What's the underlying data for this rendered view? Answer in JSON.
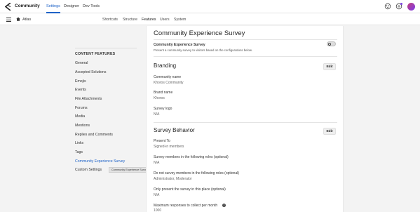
{
  "topnav": {
    "brand": "Community",
    "items": [
      "Settings",
      "Designer",
      "Dev Tools"
    ]
  },
  "subnav": {
    "home_label": "Atlas",
    "items": [
      "Shortcuts",
      "Structure",
      "Features",
      "Users",
      "System"
    ]
  },
  "sidebar": {
    "title": "CONTENT FEATURES",
    "items": [
      "General",
      "Accepted Solutions",
      "Emojis",
      "Events",
      "File Attachments",
      "Forums",
      "Media",
      "Mentions",
      "Replies and Comments",
      "Links",
      "Tags",
      "Community Experience Survey",
      "Custom Settings"
    ],
    "tooltip": "Community Experience Survey"
  },
  "main": {
    "title": "Community Experience Survey",
    "feature": {
      "title": "Community Experience Survey",
      "description": "Present a community survey to visitors based on the configurations below.",
      "enabled": false
    },
    "branding": {
      "heading": "Branding",
      "edit_label": "Edit",
      "fields": [
        {
          "label": "Community name",
          "value": "Khoros Community"
        },
        {
          "label": "Brand name",
          "value": "Khoros"
        },
        {
          "label": "Survey logo",
          "value": "N/A"
        }
      ]
    },
    "behavior": {
      "heading": "Survey Behavior",
      "edit_label": "Edit",
      "fields": [
        {
          "label": "Present To",
          "value": "Signed-in members"
        },
        {
          "label": "Survey members in the following roles (optional)",
          "value": "N/A"
        },
        {
          "label": "Do not survey members in the following roles (optional)",
          "value": "Administrator, Moderator"
        },
        {
          "label": "Only present the survey in this place (optional)",
          "value": "N/A"
        },
        {
          "label": "Maximum responses to collect per month",
          "value": "1000"
        }
      ]
    }
  },
  "colors": {
    "accent": "#1f63c7",
    "background": "#f3f3f3",
    "panel": "#ffffff"
  }
}
